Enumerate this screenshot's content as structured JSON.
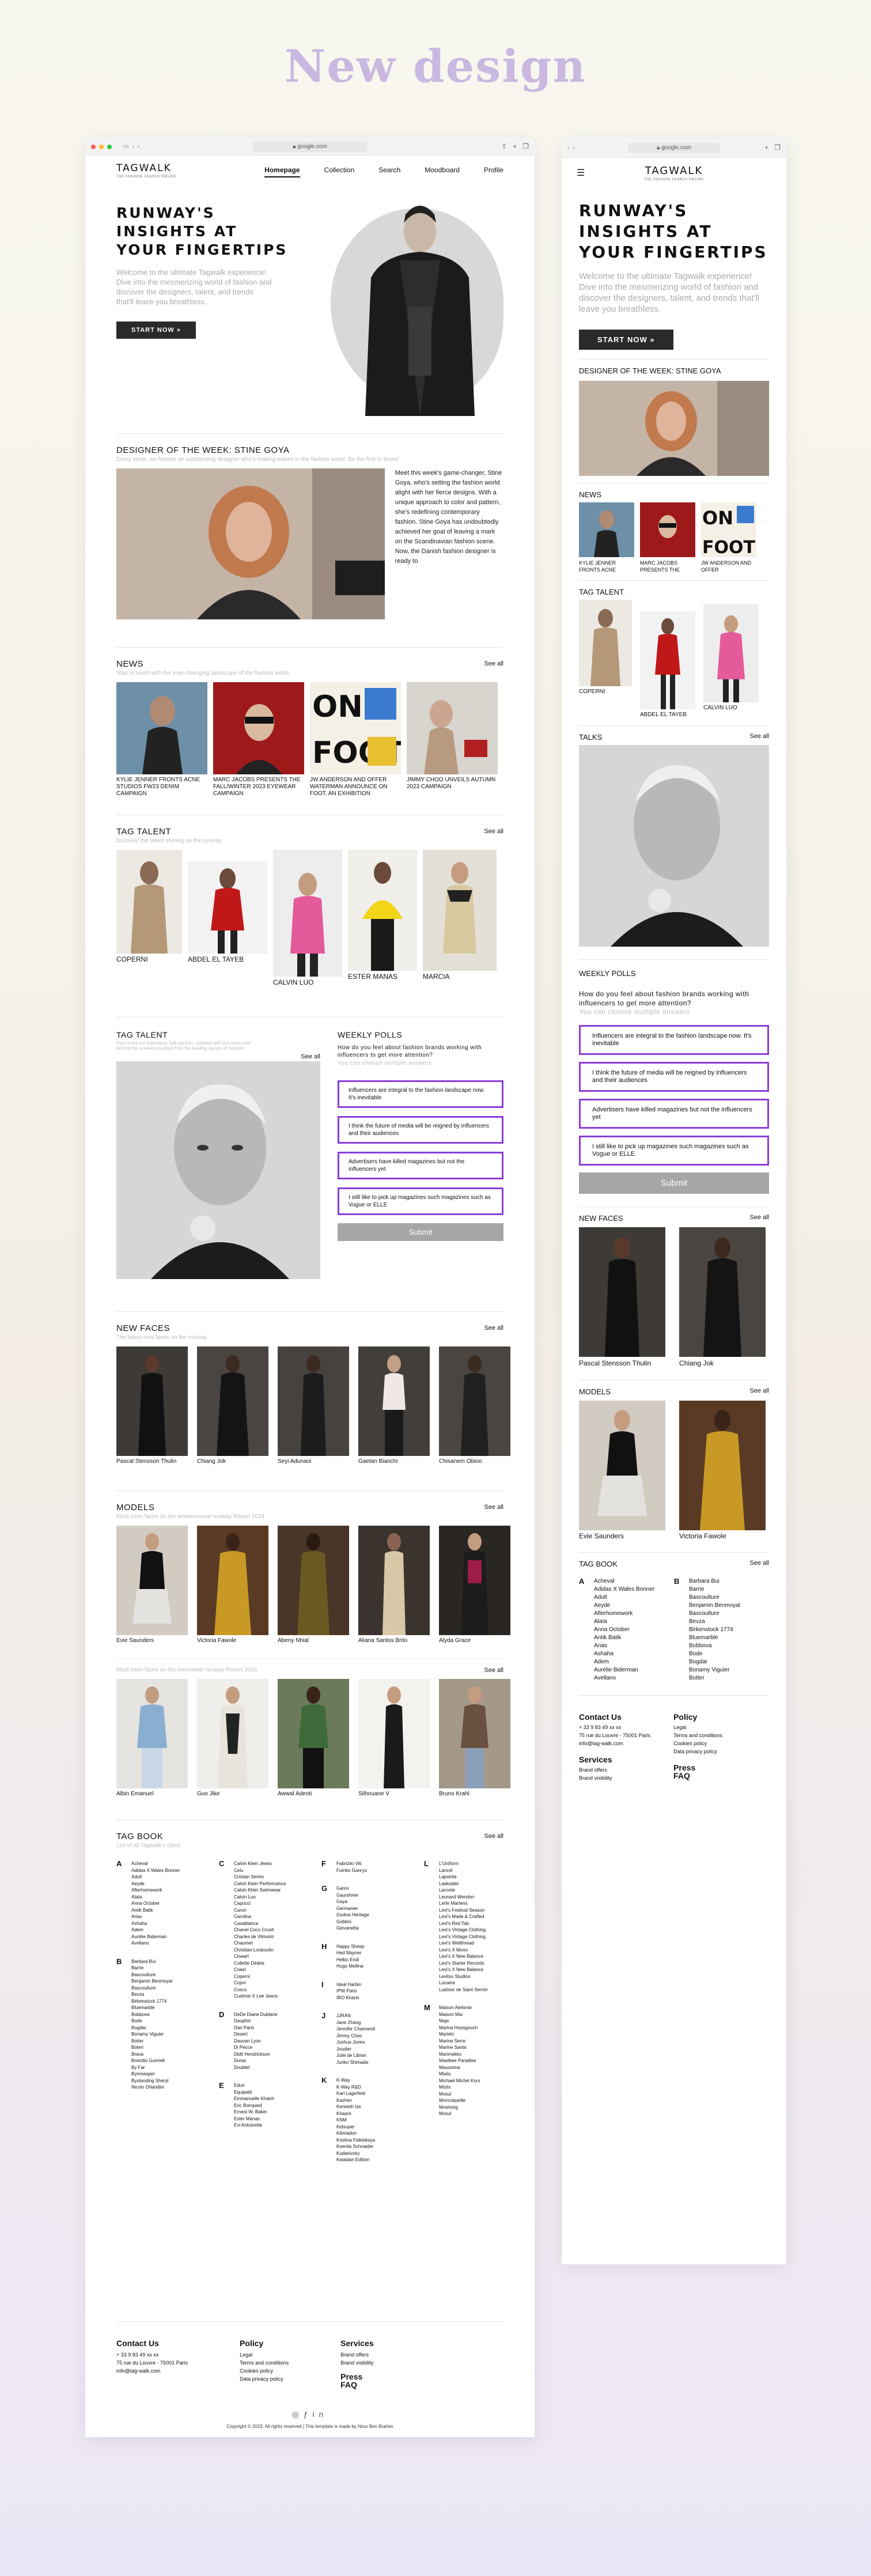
{
  "headline": "New design",
  "browser": {
    "url": "google.com"
  },
  "brand": {
    "logo": "TAGWALK",
    "tagline": "THE FASHION SEARCH ENGINE"
  },
  "nav": [
    "Homepage",
    "Collection",
    "Search",
    "Moodboard",
    "Profile"
  ],
  "hero": {
    "title": "RUNWAY'S INSIGHTS AT YOUR FINGERTIPS",
    "text": "Welcome to the ultimate Tagwalk experience! Dive into the mesmerizing world of fashion and discover the designers, talent, and trends that'll leave you breathless.",
    "button": "START NOW"
  },
  "dotw": {
    "title": "DESIGNER OF THE WEEK: STINE GOYA",
    "subtitle": "Every week, we feature an outstanding designer who's making waves in the fashion world. Be the first to know!",
    "text": "Meet this week's game-changer, Stine Goya, who's setting the fashion world alight with her fierce designs. With a unique approach to color and pattern, she's redefining contemporary fashion. Stine Goya has undoubtedly achieved her goal of leaving a mark on the Scandinavian fashion scene. Now, the Danish fashion designer is ready to"
  },
  "news": {
    "title": "NEWS",
    "subtitle": "Stay in touch with the ever-changing landscape of the fashion world",
    "see_all": "See all",
    "items": [
      "KYLIE JENNER FRONTS ACNE STUDIOS FW23 DENIM CAMPAIGN",
      "MARC JACOBS PRESENTS THE FALL/WINTER 2023 EYEWEAR CAMPAIGN",
      "JW ANDERSON AND OFFER WATERMAN ANNOUNCE ON FOOT, AN EXHIBITION",
      "JIMMY CHOO UNVEILS AUTUMN 2023 CAMPAIGN"
    ],
    "mobile_items": [
      "KYLIE JENNER FRONTS ACNE",
      "MARC JACOBS PRESENTS THE",
      "JW ANDERSON AND OFFER"
    ]
  },
  "tag_talent": {
    "title": "TAG TALENT",
    "subtitle": "Discover the talent shining on the runway",
    "see_all": "See all",
    "items": [
      "COPERNI",
      "ABDEL EL TAYEB",
      "CALVIN LUO",
      "ESTER MANAS",
      "MARCIA"
    ],
    "mobile_items": [
      "COPERNI",
      "ABDEL EL TAYEB",
      "CALVIN LUO"
    ]
  },
  "talks": {
    "title": "TAG TALENT",
    "mobile_title": "TALKS",
    "subtitle": "Don't miss our interviews Talk section, updated with the news and behind the scenes provided from the leading names of fashion",
    "see_all": "See all"
  },
  "polls": {
    "title": "WEEKLY POLLS",
    "question": "How do you feel about fashion brands working with influencers to get more attention?",
    "hint": "You can choose multiple answers",
    "options": [
      "Influencers are integral to the fashion landscape now. It's inevitable",
      "I think the future of media will be reigned by influencers and their audiences",
      "Advertisers have killed magazines but not the influencers yet",
      "I still like to pick up magazines such magazines such as Vogue or ELLE"
    ],
    "submit": "Submit"
  },
  "new_faces": {
    "title": "NEW FACES",
    "subtitle": "The latest new faces on the runway",
    "see_all": "See all",
    "items": [
      "Pascal Stensson Thulin",
      "Chiang Jok",
      "Seyi Adunaoi",
      "Gaetan Bianchi",
      "Chisanem Obioo"
    ],
    "mobile_items": [
      "Pascal Stensson Thulin",
      "Chiang Jok"
    ]
  },
  "models": {
    "title": "MODELS",
    "subtitle": "Most seen faces on the womenswear runway Resort 2024",
    "see_all": "See all",
    "items": [
      "Evie Saunders",
      "Victoria Fawole",
      "Abeny Nhial",
      "Aliana Santos Brito",
      "Alyda Grace"
    ],
    "mens_subtitle": "Most seen faces on the menswear runway Resort 2024",
    "mens_see_all": "See all",
    "mens_items": [
      "Albin Emanuel",
      "Guo Jike",
      "Awwal Adeoti",
      "Silhouane V",
      "Bruno Krahl"
    ],
    "mobile_items": [
      "Evie Saunders",
      "Victoria Fawole"
    ]
  },
  "tag_book": {
    "title": "TAG BOOK",
    "subtitle": "List of all Tagwalk's client",
    "see_all": "See all",
    "columns": [
      [
        {
          "letter": "A",
          "names": [
            "Acheval",
            "Adidas X Wales Bonner",
            "Adult",
            "Aeyde",
            "Afterhomework",
            "Alaïa",
            "Anna October",
            "Antik Batik",
            "Arias",
            "Ashaha",
            "Adem",
            "Aurélie Biderman",
            "Avellano"
          ]
        },
        {
          "letter": "B",
          "names": [
            "Barbara Bui",
            "Barrie",
            "Bascoulture",
            "Benjamin Benmoyal",
            "Bascoulture",
            "Bevza",
            "Birkenstock 1774",
            "Bluemarble",
            "Bobbova",
            "Bode",
            "Bogdar",
            "Bonamy Viguier",
            "Botter",
            "Boteri",
            "Brava",
            "Brandto Gunnell",
            "By Far",
            "Byronasper",
            "Bystanding Sheryl",
            "Nicolo Orlandini"
          ]
        }
      ],
      [
        {
          "letter": "C",
          "names": [
            "Calvin Klein Jeans",
            "Celu",
            "Cristian Series",
            "Calvin Klein Performance",
            "Calvin Klein Swimwear",
            "Calvin Luo",
            "Capucci",
            "Caron",
            "Carolina",
            "Casablanca",
            "Chanel Coco Crush",
            "Charles de Vilmorin",
            "Chaumet",
            "Christian Louboutin",
            "Cloaart",
            "Collette Dëdrie",
            "Coast",
            "Coperni",
            "Cojon",
            "Coscs",
            "Cushnie X Lee Jeans"
          ]
        },
        {
          "letter": "D",
          "names": [
            "DeDe Diane Dublane",
            "Dauphin",
            "Dari Paris",
            "Desert",
            "Dauvan Lyon",
            "Di Pecce",
            "Didit Hendrickson",
            "Dorax",
            "Doublet"
          ]
        },
        {
          "letter": "E",
          "names": [
            "Edun",
            "Equipetti",
            "Emmanuelle Khanh",
            "Eric Bompard",
            "Ernest W. Baker",
            "Ester Manas",
            "Evi Antoinette"
          ]
        }
      ],
      [
        {
          "letter": "F",
          "names": [
            "Fabriziio Viti",
            "Fumito Ganryu"
          ]
        },
        {
          "letter": "G",
          "names": [
            "Ganni",
            "Gaurshree",
            "Gaya",
            "Germanier",
            "Giuliva Heritage",
            "Gobbni",
            "Giovanetta"
          ]
        },
        {
          "letter": "H",
          "names": [
            "Happy Sheep",
            "Hed Mayner",
            "Helbo Endi",
            "Hugo Mellina"
          ]
        },
        {
          "letter": "I",
          "names": [
            "Ideal Harbin",
            "IPW Paris",
            "IRO Kharin"
          ]
        },
        {
          "letter": "J",
          "names": [
            "JJRAN",
            "Jane Zhang",
            "Jennifer Chamandi",
            "Jimmy Choo",
            "Joshua Jones",
            "Joudier",
            "Julie de Libran",
            "Junko Shimada"
          ]
        },
        {
          "letter": "K",
          "names": [
            "K-Way",
            "K-Way R&D",
            "Karl Lagerfeld",
            "Kazhen",
            "Kenneth Ize",
            "Khaore",
            "KNM",
            "Kidsuper",
            "Kiimiadon",
            "Kristina Fidelskaya",
            "Kseniia Schnaider",
            "Kudasivsky",
            "Kwaidan Edition"
          ]
        }
      ],
      [
        {
          "letter": "L",
          "names": [
            "L'Uniform",
            "Lancel",
            "Lapointe",
            "Laskuider",
            "Lacoste",
            "Leonard Wendon",
            "Lerfe Martens",
            "Levi's Festival Season",
            "Levi's Made & Crafted",
            "Levi's Red Tab",
            "Levi's Vintage Clothing",
            "Levi's Vintage Clothing",
            "Levi's Wellthread",
            "Levi's X Mono",
            "Levi's X New Balance",
            "Levi's Starter Records",
            "Levi's X New Balance",
            "Levitsu Studios",
            "Lucaine",
            "Ludovic de Saint Sernin"
          ]
        },
        {
          "letter": "M",
          "names": [
            "Maison Atelonte",
            "Maison Mai",
            "Maje",
            "Marina Hoosgouch",
            "Marielo",
            "Marine Serre",
            "Marine Santa",
            "Marimekko",
            "Mastbee Paradise",
            "Maussima",
            "Miwiu",
            "Michael Michel Kors",
            "Mistix",
            "Mosul",
            "Moncoquette",
            "Moshong",
            "Mosul"
          ]
        }
      ]
    ],
    "mobile_columns": [
      {
        "letter": "A",
        "names": [
          "Acheval",
          "Adidas X Wales Bonner",
          "Adult",
          "Aeyde",
          "Afterhomework",
          "Alaïa",
          "Anna October",
          "Antik Batik",
          "Arias",
          "Ashaha",
          "Adem",
          "Aurélie Biderman",
          "Avellano"
        ]
      },
      {
        "letter": "B",
        "names": [
          "Barbara Bui",
          "Barrie",
          "Bascoulture",
          "Benjamin Benmoyal",
          "Bascoulture",
          "Bevza",
          "Birkenstock 1774",
          "Bluemarble",
          "Bobbova",
          "Bode",
          "Bogdar",
          "Bonamy Viguier",
          "Botter"
        ]
      }
    ]
  },
  "footer": {
    "contact_title": "Contact Us",
    "contact_lines": [
      "+ 33 9 83 49 xx xx",
      "75 rue du Louvre - 75001 Paris",
      "info@tag-walk.com"
    ],
    "policy_title": "Policy",
    "policy_lines": [
      "Legal",
      "Terms and conditions",
      "Cookies policy",
      "Data privacy policy"
    ],
    "services_title": "Services",
    "services_lines": [
      "Brand offers",
      "Brand visibility"
    ],
    "press": "Press",
    "faq": "FAQ",
    "copyright": "Copyright © 2023. All rights reserved | This template is made by Nour Ben Brahim"
  },
  "colors": {
    "accent": "#8c3dd6",
    "headline": "#c9b8e0",
    "button_dark": "#2a2a2a",
    "submit": "#a6a6a6"
  },
  "icons": [
    "menu-icon",
    "share-icon",
    "plus-icon",
    "tabs-icon",
    "instagram-icon",
    "facebook-icon",
    "linkedin-icon"
  ]
}
